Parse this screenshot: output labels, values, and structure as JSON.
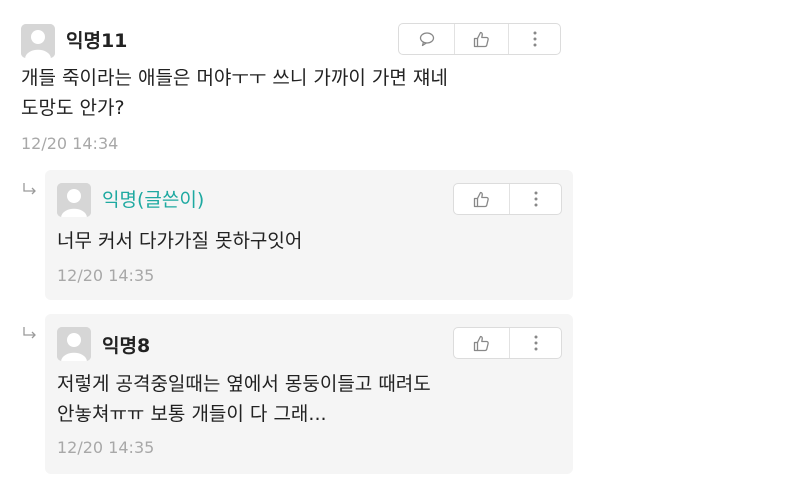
{
  "comments": [
    {
      "author": "익명11",
      "text": "개들 죽이라는 애들은 머야ㅜㅜ 쓰니 가까이 가면 쟤네\n도망도 안가?",
      "time": "12/20 14:34"
    }
  ],
  "replies": [
    {
      "author": "익명(글쓴이)",
      "text": "너무 커서 다가가질 못하구잇어",
      "time": "12/20 14:35"
    },
    {
      "author": "익명8",
      "text": "저렇게 공격중일때는 옆에서 몽둥이들고 때려도\n안놓쳐ㅠㅠ 보통 개들이 다 그래...",
      "time": "12/20 14:35"
    }
  ],
  "icons": {
    "reply": "speech-bubble-icon",
    "like": "thumbs-up-icon",
    "more": "more-vertical-icon",
    "avatar": "default-avatar-icon",
    "reply_indicator": "reply-arrow-icon"
  },
  "colors": {
    "author_accent": "#1ea9a1",
    "timestamp": "#a8a8a8",
    "reply_background": "#f5f5f5"
  }
}
